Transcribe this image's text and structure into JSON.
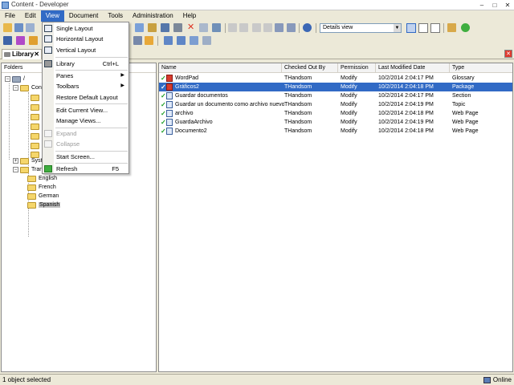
{
  "window": {
    "title": "Content - Developer"
  },
  "menubar": {
    "items": [
      "File",
      "Edit",
      "View",
      "Document",
      "Tools",
      "Administration",
      "Help"
    ]
  },
  "toolbar": {
    "view_select": "Details view"
  },
  "view_menu": {
    "single_layout": "Single Layout",
    "horizontal_layout": "Horizontal Layout",
    "vertical_layout": "Vertical Layout",
    "library": "Library",
    "library_shortcut": "Ctrl+L",
    "panes": "Panes",
    "toolbars": "Toolbars",
    "restore_default_layout": "Restore Default Layout",
    "edit_current_view": "Edit Current View...",
    "manage_views": "Manage Views...",
    "expand": "Expand",
    "collapse": "Collapse",
    "start_screen": "Start Screen...",
    "refresh": "Refresh",
    "refresh_shortcut": "F5"
  },
  "library_tab": {
    "label": "Library",
    "close": "✕"
  },
  "folders": {
    "header": "Folders",
    "root": "/",
    "content_label": "Cont",
    "system_label": "Syst",
    "translations_label": "Tran",
    "languages": [
      "English",
      "French",
      "German",
      "Spanish"
    ]
  },
  "grid": {
    "headers": {
      "name": "Name",
      "checked_out_by": "Checked Out By",
      "permission": "Permission",
      "last_modified": "Last Modified Date",
      "type": "Type"
    },
    "rows": [
      {
        "name": "WordPad",
        "checked_out_by": "THandsom",
        "permission": "Modify",
        "last_modified": "10/2/2014 2:04:17 PM",
        "type": "Glossary"
      },
      {
        "name": "Gráficos2",
        "checked_out_by": "THandsom",
        "permission": "Modify",
        "last_modified": "10/2/2014 2:04:18 PM",
        "type": "Package"
      },
      {
        "name": "Guardar documentos",
        "checked_out_by": "THandsom",
        "permission": "Modify",
        "last_modified": "10/2/2014 2:04:17 PM",
        "type": "Section"
      },
      {
        "name": "Guardar un documento como archivo nuevo",
        "checked_out_by": "THandsom",
        "permission": "Modify",
        "last_modified": "10/2/2014 2:04:19 PM",
        "type": "Topic"
      },
      {
        "name": "archivo",
        "checked_out_by": "THandsom",
        "permission": "Modify",
        "last_modified": "10/2/2014 2:04:18 PM",
        "type": "Web Page"
      },
      {
        "name": "GuardaArchivo",
        "checked_out_by": "THandsom",
        "permission": "Modify",
        "last_modified": "10/2/2014 2:04:19 PM",
        "type": "Web Page"
      },
      {
        "name": "Documento2",
        "checked_out_by": "THandsom",
        "permission": "Modify",
        "last_modified": "10/2/2014 2:04:18 PM",
        "type": "Web Page"
      }
    ]
  },
  "status": {
    "text": "1 object selected",
    "connection": "Online"
  }
}
